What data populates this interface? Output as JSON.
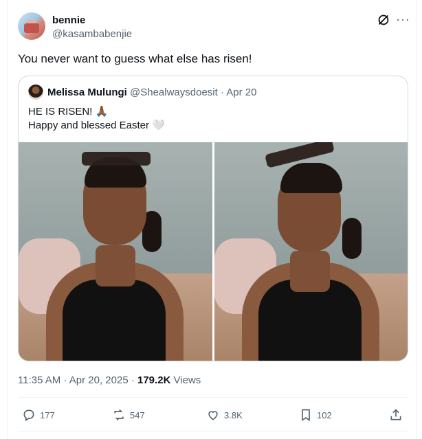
{
  "author": {
    "display_name": "bennie",
    "handle": "@kasambabenjie"
  },
  "post_text": "You never want to guess what else has risen!",
  "quoted": {
    "display_name": "Melissa Mulungi",
    "meta": "@Shealwaysdoesit · Apr 20",
    "line1": "HE IS RISEN! 🙏🏾",
    "line2": "Happy and blessed Easter 🤍"
  },
  "timestamp": {
    "time_date": "11:35 AM · Apr 20, 2025 · ",
    "views_count": "179.2K",
    "views_label": " Views"
  },
  "actions": {
    "replies": "177",
    "reposts": "547",
    "likes": "3.8K",
    "bookmarks": "102"
  },
  "icons": [
    "grok-icon",
    "more-icon",
    "reply-icon",
    "repost-icon",
    "like-icon",
    "bookmark-icon",
    "share-icon"
  ],
  "colors": {
    "text": "#0f1419",
    "secondary": "#536471",
    "border": "#cfd9de"
  }
}
